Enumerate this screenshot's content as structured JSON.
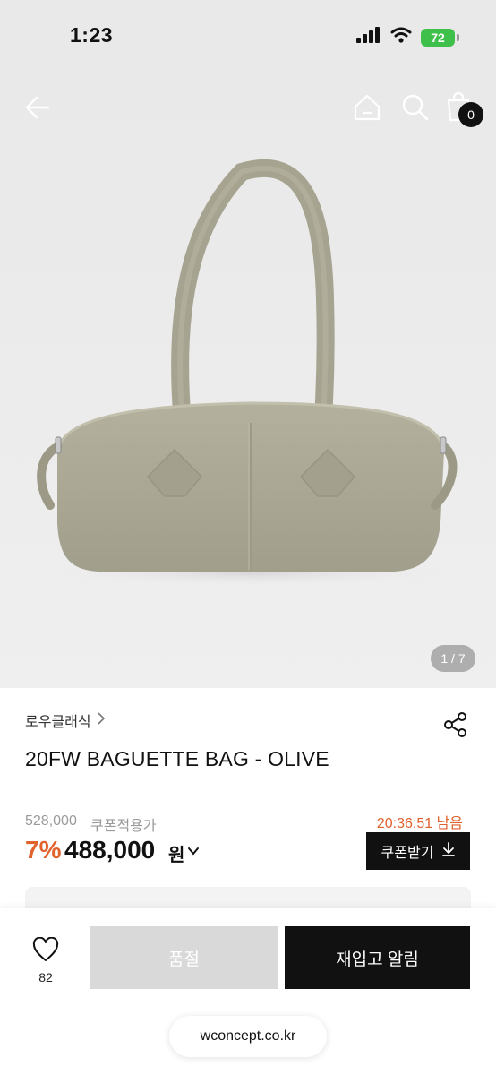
{
  "status_bar": {
    "time": "1:23",
    "battery": "72",
    "icons": [
      "signal-icon",
      "wifi-icon",
      "battery-icon"
    ]
  },
  "header": {
    "icons": [
      "back-arrow-icon",
      "home-icon",
      "search-icon",
      "shopping-bag-icon"
    ],
    "cart_count": "0"
  },
  "gallery": {
    "indicator": "1 / 7",
    "image": "olive-baguette-bag-photo"
  },
  "product": {
    "brand": "로우클래식",
    "title": "20FW BAGUETTE BAG - OLIVE",
    "original_price": "528,000",
    "coupon_note": "쿠폰적용가",
    "timer": "20:36:51 남음",
    "discount": "7%",
    "sale_price": "488,000",
    "currency": "원",
    "coupon_button": "쿠폰받기"
  },
  "bottom_bar": {
    "like_count": "82",
    "soldout_label": "품절",
    "restock_label": "재입고 알림"
  },
  "browser": {
    "url": "wconcept.co.kr"
  },
  "colors": {
    "accent": "#e0622d",
    "bag_olive": "#a9a793",
    "button_dark": "#111111",
    "button_disabled": "#d9d9d9"
  }
}
